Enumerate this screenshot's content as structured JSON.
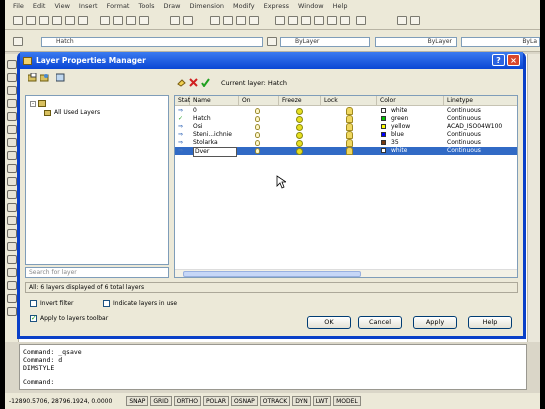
{
  "menubar": [
    "File",
    "Edit",
    "View",
    "Insert",
    "Format",
    "Tools",
    "Draw",
    "Dimension",
    "Modify",
    "Express",
    "Window",
    "Help"
  ],
  "toolbar": {
    "layer_combo": "Hatch",
    "color_combo": "ByLayer",
    "linetype_combo": "ByLayer",
    "lineweight_combo": "ByLa"
  },
  "dialog": {
    "title": "Layer Properties Manager",
    "current_layer": "Current layer: Hatch",
    "tree_label": "All Used Layers",
    "search_placeholder": "Search for layer",
    "columns": [
      "Stat",
      "Name",
      "On",
      "Freeze",
      "Lock",
      "Color",
      "Linetype"
    ],
    "rows": [
      {
        "name": "0",
        "color_name": "white",
        "color_hex": "#ffffff",
        "linetype": "Continuous",
        "current": false
      },
      {
        "name": "Hatch",
        "color_name": "green",
        "color_hex": "#00c000",
        "linetype": "Continuous",
        "current": true
      },
      {
        "name": "Osi",
        "color_name": "yellow",
        "color_hex": "#ffff00",
        "linetype": "ACAD_ISO04W100",
        "current": false
      },
      {
        "name": "Steni...ichnie",
        "color_name": "blue",
        "color_hex": "#0000ff",
        "linetype": "Continuous",
        "current": false
      },
      {
        "name": "Stolarka",
        "color_name": "35",
        "color_hex": "#7a3a10",
        "linetype": "Continuous",
        "current": false
      },
      {
        "name": "Dver",
        "color_name": "white",
        "color_hex": "#ffffff",
        "linetype": "Continuous",
        "current": false,
        "selected": true
      }
    ],
    "status_text": "All: 6 layers displayed of 6 total layers",
    "invert_filter": "Invert filter",
    "indicate_layers": "Indicate layers in use",
    "apply_toolbar": "Apply to layers toolbar",
    "buttons": {
      "ok": "OK",
      "cancel": "Cancel",
      "apply": "Apply",
      "help": "Help"
    }
  },
  "command_lines": [
    "Command:  _qsave",
    "Command:  d",
    "DIMSTYLE",
    "Command:"
  ],
  "statusbar": {
    "coords": "-12890.5706, 28796.1924, 0.0000",
    "toggles": [
      "SNAP",
      "GRID",
      "ORTHO",
      "POLAR",
      "OSNAP",
      "OTRACK",
      "DYN",
      "LWT",
      "MODEL"
    ]
  }
}
